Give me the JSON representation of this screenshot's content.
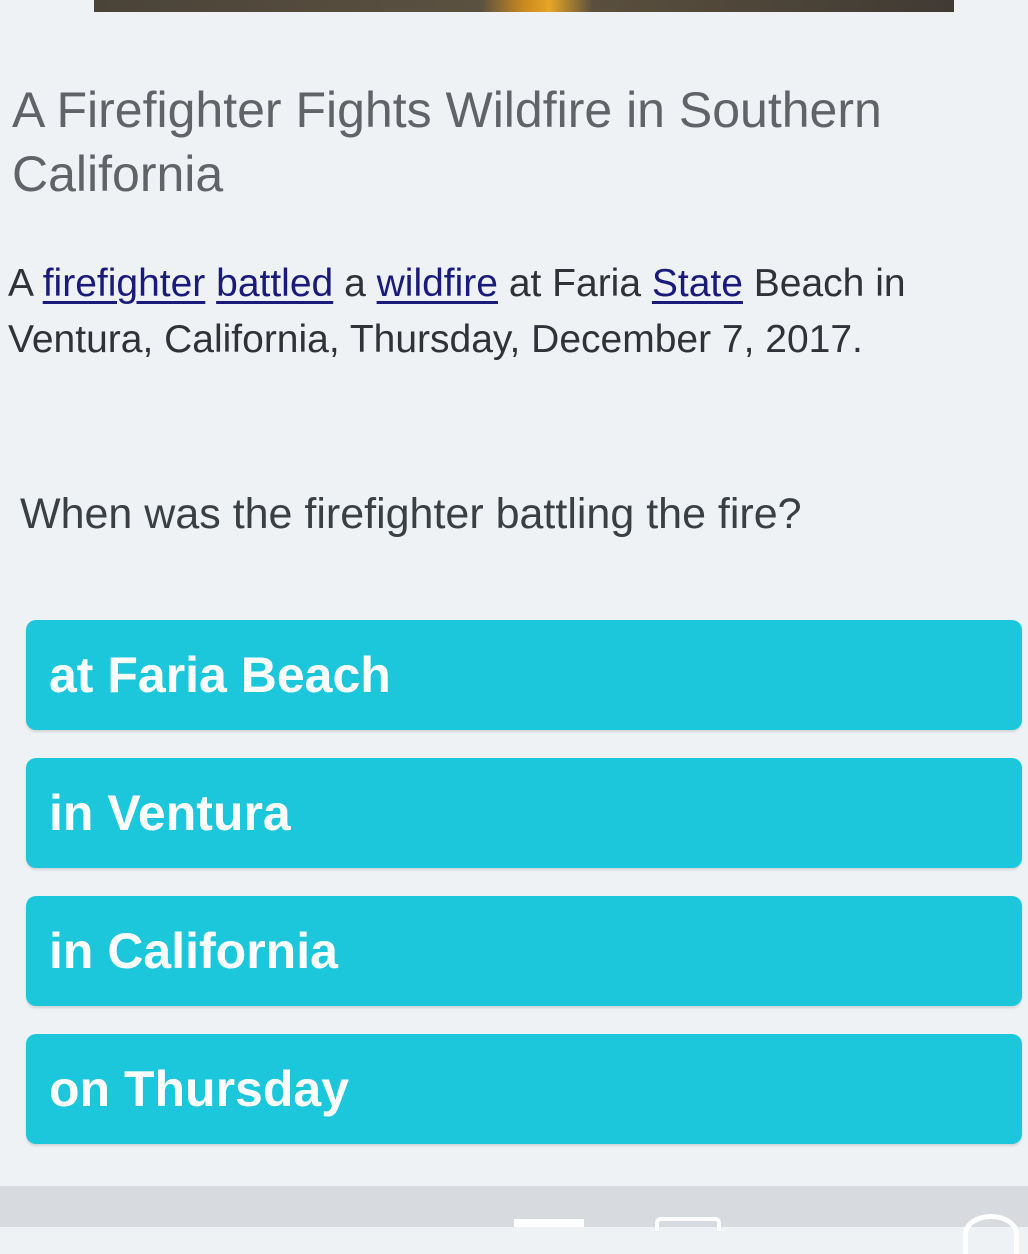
{
  "article": {
    "title": "A Firefighter Fights Wildfire in Southern California",
    "body": {
      "t1": "A ",
      "link1": "firefighter",
      "t2": " ",
      "link2": "battled",
      "t3": " a ",
      "link3": "wildfire",
      "t4": " at Faria ",
      "link4": "State",
      "t5": " Beach in Ventura, California, Thursday, December 7, 2017."
    }
  },
  "quiz": {
    "question": "When was the firefighter battling the fire?",
    "options": [
      {
        "label": "at Faria Beach"
      },
      {
        "label": "in Ventura"
      },
      {
        "label": "in California"
      },
      {
        "label": "on Thursday"
      }
    ]
  },
  "colors": {
    "option_background": "#1dc7db",
    "page_background": "#eef2f5",
    "link": "#1a1a7a"
  }
}
